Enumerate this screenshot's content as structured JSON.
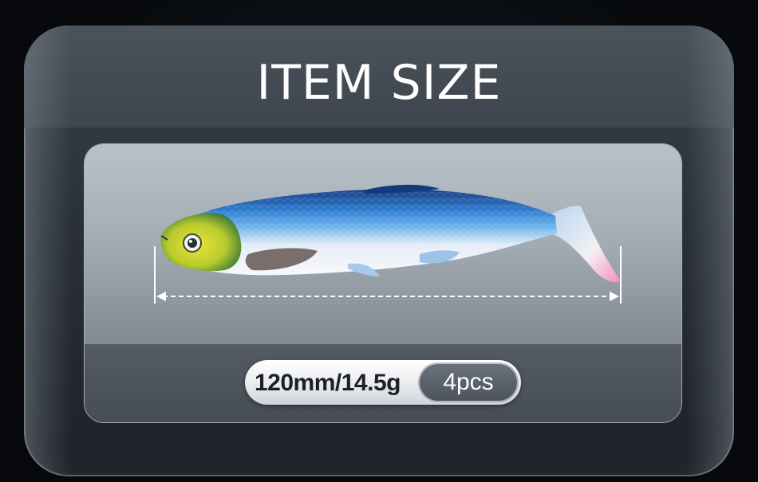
{
  "title": "ITEM SIZE",
  "spec": {
    "size_weight": "120mm/14.5g",
    "count": "4pcs"
  },
  "icons": {
    "product": "swimbait-fish",
    "measure": "dimension-arrow"
  }
}
